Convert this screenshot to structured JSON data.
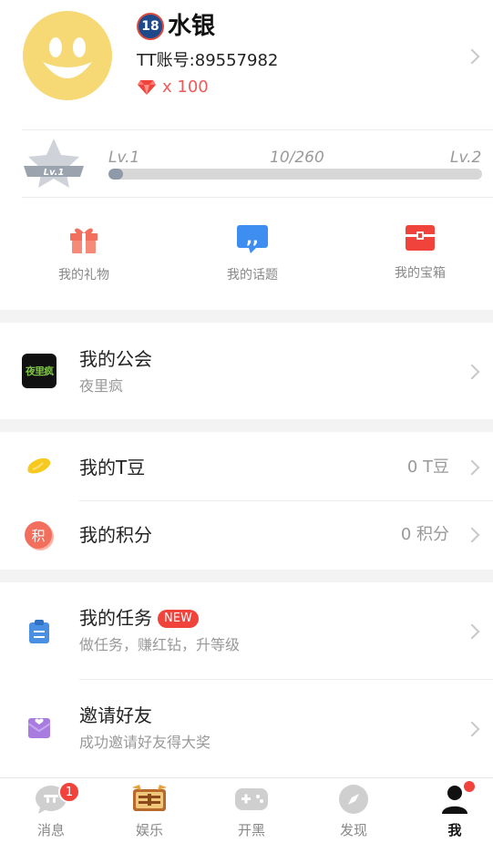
{
  "profile": {
    "age_badge": "18",
    "nickname": "水银",
    "account": "TT账号:89557982",
    "gems": "x 100"
  },
  "level": {
    "badge": "Lv.1",
    "current": "Lv.1",
    "progress_text": "10/260",
    "next": "Lv.2",
    "progress": 0.038
  },
  "shortcuts": [
    {
      "label": "我的礼物",
      "icon": "gift-icon"
    },
    {
      "label": "我的话题",
      "icon": "topic-icon"
    },
    {
      "label": "我的宝箱",
      "icon": "treasure-chest-icon"
    }
  ],
  "guild": {
    "title": "我的公会",
    "subtitle": "夜里疯",
    "logo_text": "夜里疯"
  },
  "tdou": {
    "title": "我的T豆",
    "value": "0 T豆"
  },
  "points": {
    "title": "我的积分",
    "value": "0 积分",
    "icon_char": "积"
  },
  "tasks": {
    "title": "我的任务",
    "badge": "NEW",
    "subtitle": "做任务，赚红钻，升等级"
  },
  "invite": {
    "title": "邀请好友",
    "subtitle": "成功邀请好友得大奖"
  },
  "tabs": [
    {
      "label": "消息",
      "badge": "1"
    },
    {
      "label": "娱乐"
    },
    {
      "label": "开黑"
    },
    {
      "label": "发现"
    },
    {
      "label": "我"
    }
  ],
  "colors": {
    "accent_red": "#f0433b",
    "gem": "#f05a5a",
    "avatar": "#f6d874"
  }
}
